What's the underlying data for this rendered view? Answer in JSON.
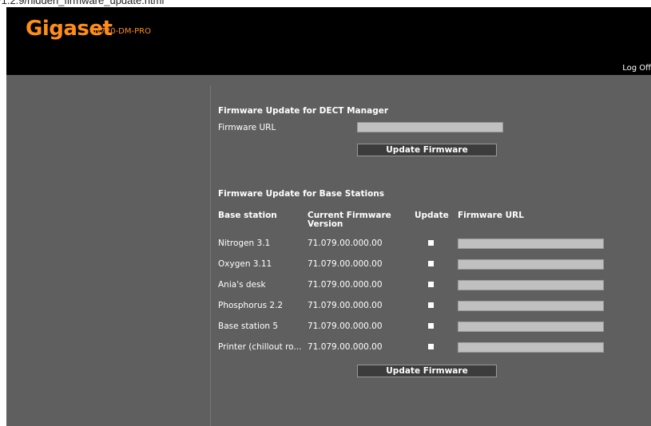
{
  "browser": {
    "url_fragment": "/1.2.9/hidden_firmware_update.html"
  },
  "header": {
    "brand": "Gigaset",
    "model": "N720-DM-PRO",
    "logoff_label": "Log Off"
  },
  "dect_manager": {
    "title": "Firmware Update for DECT Manager",
    "url_label": "Firmware URL",
    "url_value": "",
    "button_label": "Update Firmware"
  },
  "base_stations": {
    "title": "Firmware Update for Base Stations",
    "headers": {
      "station": "Base station",
      "version": "Current Firmware Version",
      "update": "Update",
      "url": "Firmware URL"
    },
    "rows": [
      {
        "name": "Nitrogen 3.1",
        "version": "71.079.00.000.00",
        "update": false,
        "url": ""
      },
      {
        "name": "Oxygen 3.11",
        "version": "71.079.00.000.00",
        "update": false,
        "url": ""
      },
      {
        "name": "Ania's desk",
        "version": "71.079.00.000.00",
        "update": false,
        "url": ""
      },
      {
        "name": "Phosphorus 2.2",
        "version": "71.079.00.000.00",
        "update": false,
        "url": ""
      },
      {
        "name": "Base station 5",
        "version": "71.079.00.000.00",
        "update": false,
        "url": ""
      },
      {
        "name": "Printer (chillout ro...",
        "version": "71.079.00.000.00",
        "update": false,
        "url": ""
      }
    ],
    "button_label": "Update Firmware"
  },
  "colors": {
    "brand": "#ff8d1a",
    "header_bg": "#000000",
    "content_bg": "#5f5f5f",
    "input_bg": "#c0c0c0",
    "button_bg": "#3c3c3c"
  }
}
